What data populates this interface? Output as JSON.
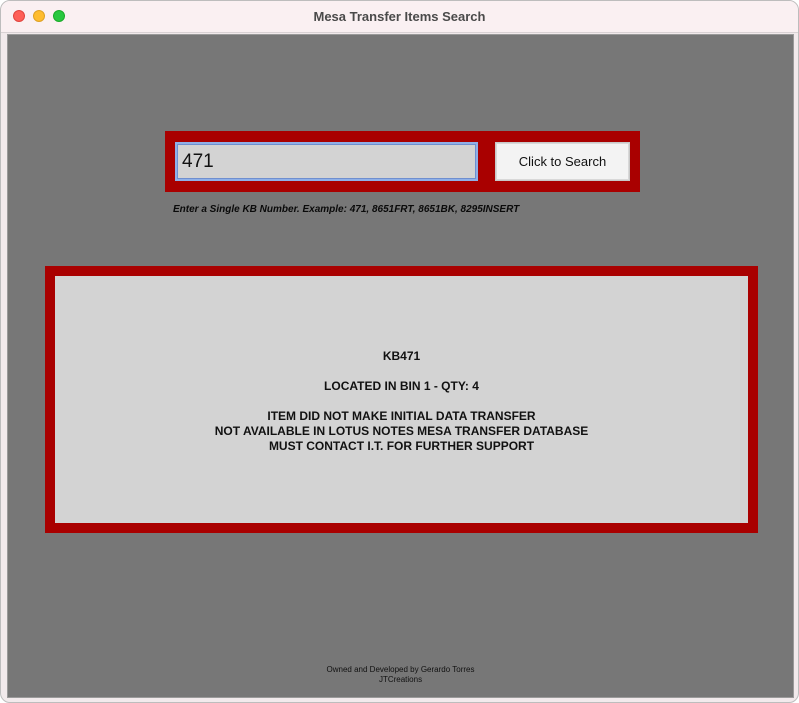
{
  "window": {
    "title": "Mesa Transfer Items Search"
  },
  "search": {
    "value": "471",
    "button_label": "Click to Search",
    "hint": "Enter a Single KB Number. Example: 471, 8651FRT, 8651BK, 8295INSERT"
  },
  "result": {
    "item": "KB471",
    "location": "LOCATED IN BIN 1 - QTY: 4",
    "message_line1": "ITEM DID NOT MAKE INITIAL DATA TRANSFER",
    "message_line2": "NOT AVAILABLE IN LOTUS NOTES MESA TRANSFER DATABASE",
    "message_line3": "MUST CONTACT I.T. FOR FURTHER SUPPORT"
  },
  "footer": {
    "line1": "Owned and Developed by Gerardo Torres",
    "line2": "JTCreations"
  },
  "colors": {
    "frame_red": "#a90000",
    "background_gray": "#777777",
    "panel_gray": "#d3d3d3",
    "input_focus": "#8fb0e8"
  }
}
